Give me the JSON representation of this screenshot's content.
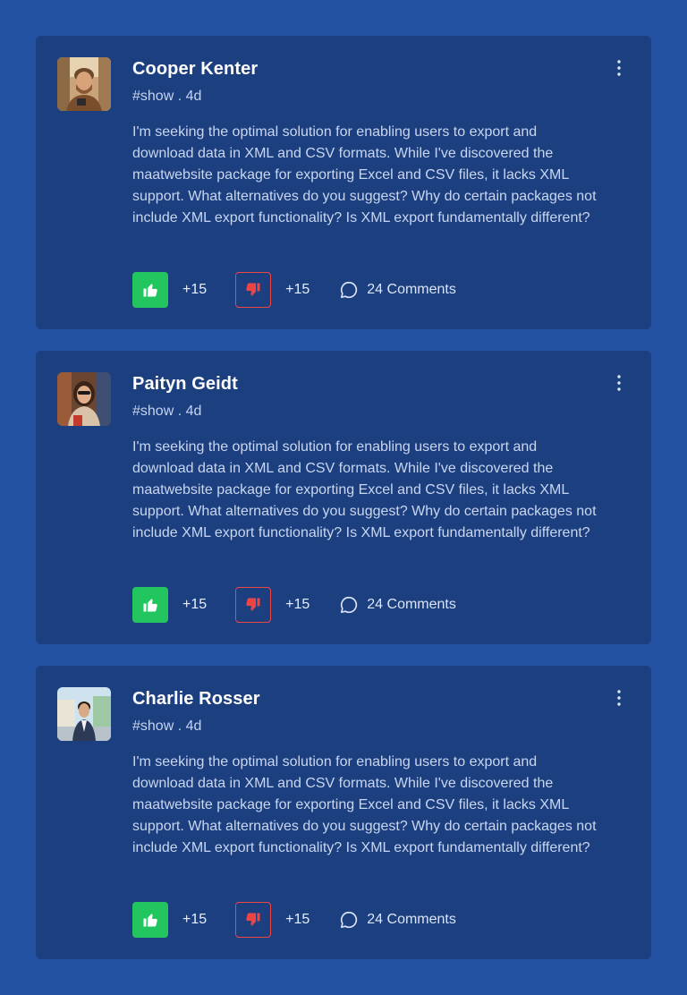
{
  "posts": [
    {
      "author": "Cooper Kenter",
      "meta": "#show . 4d",
      "body": "I'm seeking the optimal solution for enabling users to export and download data in XML and CSV formats. While I've discovered the maatwebsite package for exporting Excel and CSV files, it lacks XML support. What alternatives do you suggest? Why do certain packages not include XML export functionality? Is XML export fundamentally different?",
      "likes": "+15",
      "dislikes": "+15",
      "comments": "24 Comments"
    },
    {
      "author": "Paityn Geidt",
      "meta": "#show . 4d",
      "body": "I'm seeking the optimal solution for enabling users to export and download data in XML and CSV formats. While I've discovered the maatwebsite package for exporting Excel and CSV files, it lacks XML support. What alternatives do you suggest? Why do certain packages not include XML export functionality? Is XML export fundamentally different?",
      "likes": "+15",
      "dislikes": "+15",
      "comments": "24 Comments"
    },
    {
      "author": "Charlie Rosser",
      "meta": "#show . 4d",
      "body": "I'm seeking the optimal solution for enabling users to export and download data in XML and CSV formats. While I've discovered the maatwebsite package for exporting Excel and CSV files, it lacks XML support. What alternatives do you suggest? Why do certain packages not include XML export functionality? Is XML export fundamentally different?",
      "likes": "+15",
      "dislikes": "+15",
      "comments": "24 Comments"
    }
  ],
  "colors": {
    "page_background": "#2352a3",
    "card_background": "#1c3f80",
    "like": "#22c55e",
    "dislike": "#ef4444"
  },
  "icons": {
    "menu": "more-vertical-icon",
    "like": "thumbs-up-icon",
    "dislike": "thumbs-down-icon",
    "comments": "comment-bubble-icon"
  }
}
